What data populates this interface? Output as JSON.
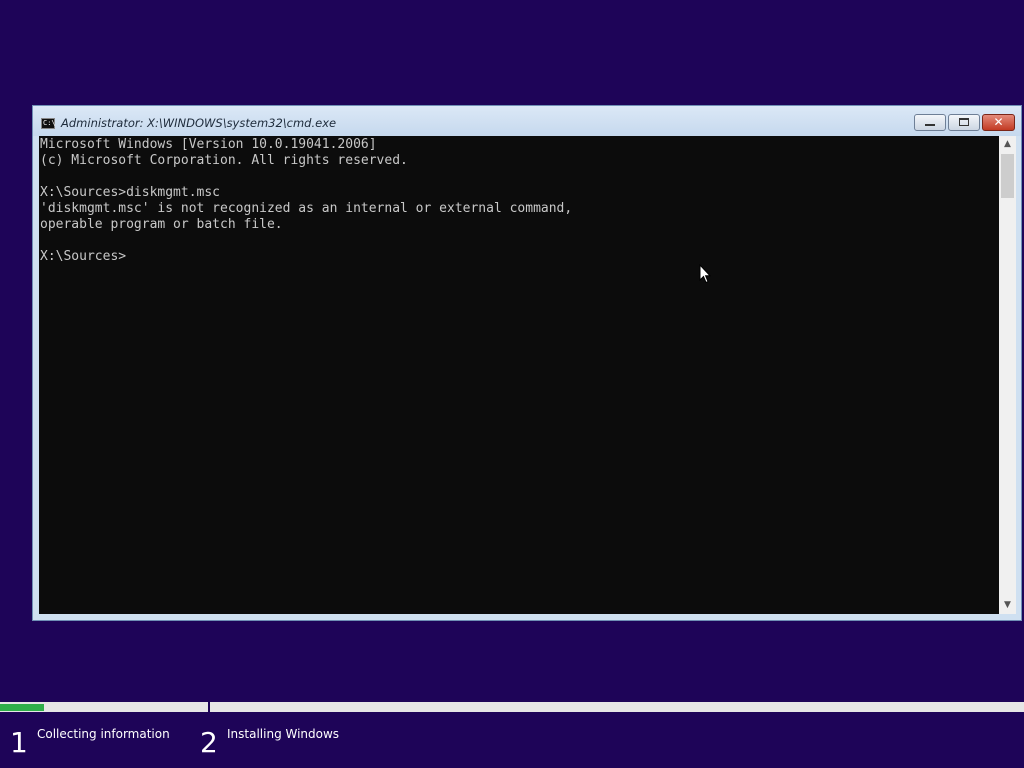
{
  "window": {
    "title": "Administrator: X:\\WINDOWS\\system32\\cmd.exe",
    "icon_label": "C:\\",
    "buttons": {
      "close_glyph": "✕"
    }
  },
  "console": {
    "lines": [
      "Microsoft Windows [Version 10.0.19041.2006]",
      "(c) Microsoft Corporation. All rights reserved.",
      "",
      "X:\\Sources>diskmgmt.msc",
      "'diskmgmt.msc' is not recognized as an internal or external command,",
      "operable program or batch file.",
      "",
      "X:\\Sources>"
    ]
  },
  "scrollbar": {
    "up_glyph": "▲",
    "down_glyph": "▼"
  },
  "setup": {
    "progress_fraction": 0.043,
    "steps": [
      {
        "number": "1",
        "label": "Collecting information"
      },
      {
        "number": "2",
        "label": "Installing Windows"
      }
    ]
  },
  "colors": {
    "background": "#1e0458",
    "progress": "#2fae4a",
    "console_bg": "#0c0c0c",
    "console_text": "#c8c8c8"
  }
}
